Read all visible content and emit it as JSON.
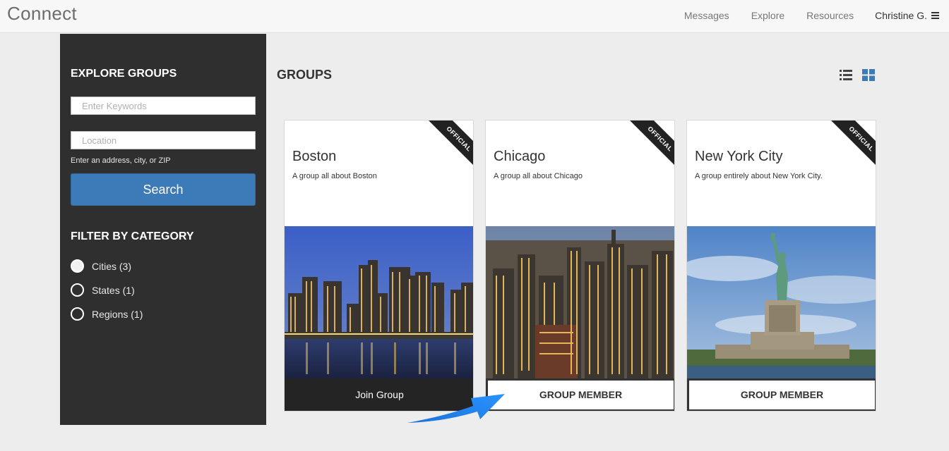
{
  "app": {
    "brand": "Connect"
  },
  "nav": {
    "items": [
      "Messages",
      "Explore",
      "Resources"
    ],
    "user": "Christine G."
  },
  "sidebar": {
    "title": "EXPLORE GROUPS",
    "keywords_placeholder": "Enter Keywords",
    "location_placeholder": "Location",
    "location_hint": "Enter an address, city, or ZIP",
    "search_label": "Search",
    "filter_title": "FILTER BY CATEGORY",
    "filters": [
      {
        "label": "Cities (3)",
        "selected": true
      },
      {
        "label": "States (1)",
        "selected": false
      },
      {
        "label": "Regions (1)",
        "selected": false
      }
    ]
  },
  "main": {
    "title": "GROUPS",
    "view_icons": [
      "list-view-icon",
      "grid-view-icon"
    ],
    "active_view": "grid",
    "accent_color": "#3d7ab8"
  },
  "cards": [
    {
      "title": "Boston",
      "description": "A group all about Boston",
      "badge": "OFFICIAL",
      "button": "Join Group",
      "image": "boston-skyline-night"
    },
    {
      "title": "Chicago",
      "description": "A group all about Chicago",
      "badge": "OFFICIAL",
      "button": "GROUP MEMBER",
      "image": "chicago-aerial-dusk"
    },
    {
      "title": "New York City",
      "description": "A group entirely about New York City.",
      "badge": "OFFICIAL",
      "button": "GROUP MEMBER",
      "image": "statue-of-liberty"
    }
  ]
}
